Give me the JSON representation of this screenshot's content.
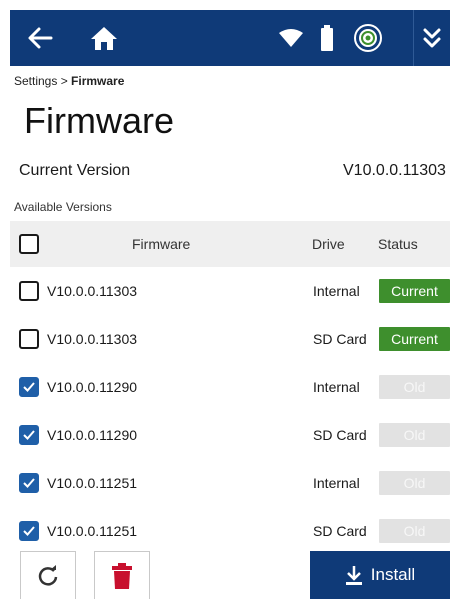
{
  "header": {
    "icons": [
      "back-arrow-icon",
      "home-icon",
      "wifi-icon",
      "battery-icon",
      "target-status-icon",
      "double-chevron-down-icon"
    ]
  },
  "breadcrumb": {
    "parent": "Settings >",
    "current": "Firmware"
  },
  "page_title": "Firmware",
  "current_version": {
    "label": "Current Version",
    "value": "V10.0.0.11303"
  },
  "available_label": "Available Versions",
  "table": {
    "headers": {
      "firmware": "Firmware",
      "drive": "Drive",
      "status": "Status"
    },
    "rows": [
      {
        "version": "V10.0.0.11303",
        "drive": "Internal",
        "status": "Current",
        "checked": false
      },
      {
        "version": "V10.0.0.11303",
        "drive": "SD Card",
        "status": "Current",
        "checked": false
      },
      {
        "version": "V10.0.0.11290",
        "drive": "Internal",
        "status": "Old",
        "checked": true
      },
      {
        "version": "V10.0.0.11290",
        "drive": "SD Card",
        "status": "Old",
        "checked": true
      },
      {
        "version": "V10.0.0.11251",
        "drive": "Internal",
        "status": "Old",
        "checked": true
      },
      {
        "version": "V10.0.0.11251",
        "drive": "SD Card",
        "status": "Old",
        "checked": true
      }
    ]
  },
  "footer": {
    "install_label": "Install"
  },
  "colors": {
    "brand": "#0f3a78",
    "current": "#3e8f2d",
    "old": "#e2e2e2",
    "checkbox": "#1f5fa8",
    "delete": "#c8102e"
  }
}
